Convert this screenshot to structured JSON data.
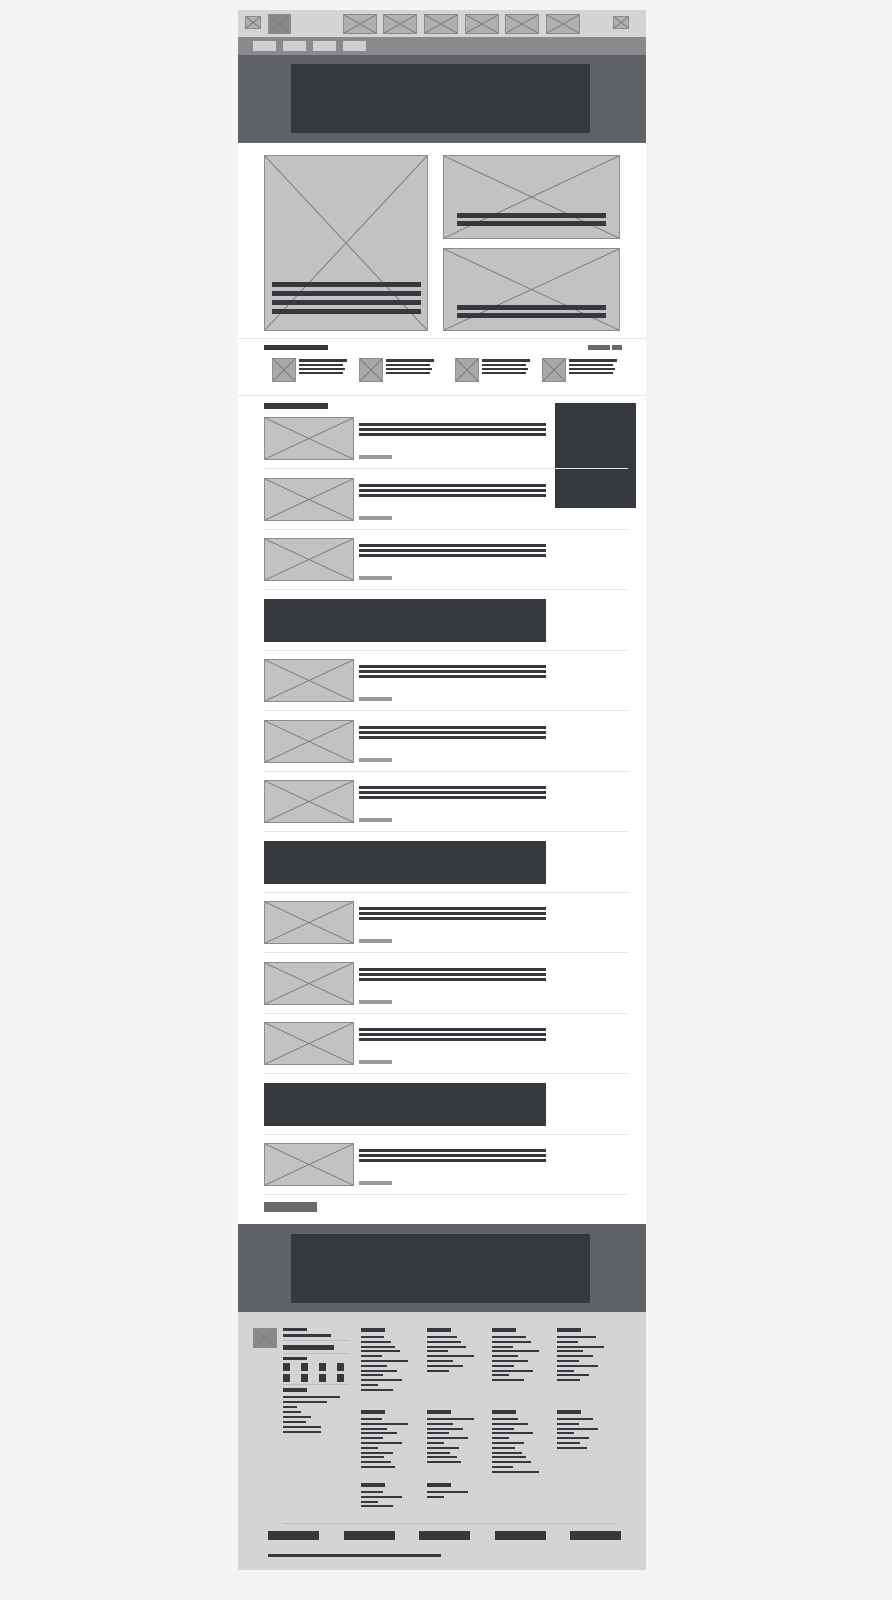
{
  "colors": {
    "background": "#f4f4f4",
    "top_bar": "#d4d4d4",
    "nav_bar": "#8a8a8a",
    "banner": "#5f6266",
    "dark_block": "#35383d",
    "placeholder": "#c2c2c2",
    "footer": "#d4d4d4",
    "content": "#ffffff"
  },
  "top_bar": {
    "icons": [
      "small-image-icon",
      "logo-image-icon",
      "nav-image-1",
      "nav-image-2",
      "nav-image-3",
      "nav-image-4",
      "nav-image-5",
      "nav-image-6",
      "close-image-icon"
    ]
  },
  "nav_bar": {
    "tab_count": 4
  },
  "featured": {
    "main_lines": 4,
    "side_items": 2
  },
  "strip": {
    "items": 4
  },
  "list": {
    "items": [
      "article",
      "article",
      "article",
      "ad",
      "article",
      "article",
      "article",
      "ad",
      "article",
      "article",
      "article",
      "ad",
      "article"
    ]
  },
  "footer": {
    "column_groups": 10,
    "bottom_links": 5
  }
}
